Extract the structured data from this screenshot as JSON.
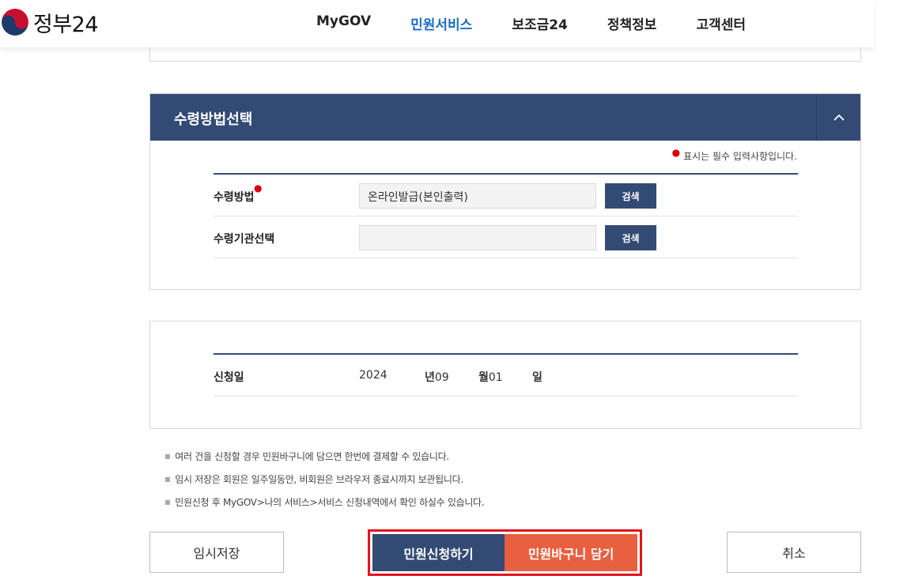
{
  "header": {
    "logo_text": "정부24",
    "nav": [
      "MyGOV",
      "민원서비스",
      "보조금24",
      "정책정보",
      "고객센터"
    ],
    "active_nav": "민원서비스"
  },
  "receive_section": {
    "title": "수령방법선택",
    "required_note": "표시는 필수 입력사항입니다.",
    "rows": [
      {
        "label": "수령방법",
        "value": "온라인발급(본인출력)",
        "button": "검색",
        "required": true
      },
      {
        "label": "수령기관선택",
        "value": "",
        "button": "검색",
        "required": false
      }
    ]
  },
  "date_section": {
    "label": "신청일",
    "year": "2024",
    "year_unit": "년",
    "month": "09",
    "month_unit": "월",
    "day": "01",
    "day_unit": "일"
  },
  "notes": [
    "여러 건을 신청할 경우 민원바구니에 담으면 한번에 결제할 수 있습니다.",
    "임시 저장은 회원은 일주일동안, 비회원은 브라우저 종료시까지 보관됩니다.",
    "민원신청 후 MyGOV>나의 서비스>서비스 신청내역에서 확인 하실수 있습니다."
  ],
  "buttons": {
    "temp_save": "임시저장",
    "apply": "민원신청하기",
    "cart": "민원바구니 담기",
    "cancel": "취소"
  },
  "colors": {
    "primary": "#334b74",
    "accent": "#e8603f",
    "active_nav": "#1a6cc2",
    "highlight": "#e3141c"
  }
}
